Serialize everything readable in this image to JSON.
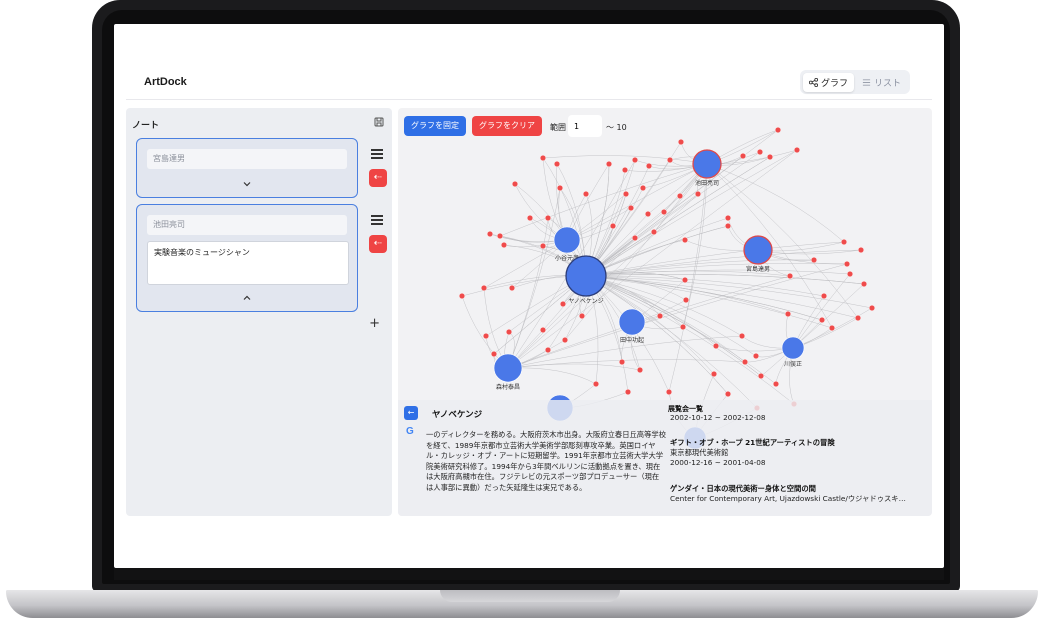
{
  "app": {
    "title": "ArtDock"
  },
  "view_toggle": {
    "graph_label": "グラフ",
    "list_label": "リスト",
    "active": "graph"
  },
  "notes_panel": {
    "title": "ノート",
    "cards": [
      {
        "name": "宮島達男",
        "memo": ""
      },
      {
        "name": "池田亮司",
        "memo": "実験音楽のミュージシャン"
      }
    ],
    "add_label": "+"
  },
  "graph_panel": {
    "fix_button": "グラフを固定",
    "clear_button": "グラフをクリア",
    "range_label": "範囲",
    "range_value": "1",
    "range_max_text": "〜 10",
    "colors": {
      "artist_node": "#4a78e8",
      "exhibition_node": "#ef4b4b",
      "edge": "#b9b9bd"
    },
    "labels": {
      "ikeda": "池田亮司",
      "koizumi": "小谷元彦",
      "miyajima": "宮島達男",
      "yanobe": "ヤノベケンジ",
      "tanaka": "田中功起",
      "morimura": "森村泰昌",
      "kawamata": "川俣正"
    }
  },
  "info_panel": {
    "name": "ヤノベケンジ",
    "bio": "一のディレクターを務める。大阪府茨木市出身。大阪府立春日丘高等学校を経て、1989年京都市立芸術大学美術学部彫刻専攻卒業。英国ロイヤル・カレッジ・オブ・アートに短期留学。1991年京都市立芸術大学大学院美術研究科修了。1994年から3年間ベルリンに活動拠点を置き、現在は大阪府高槻市在住。フジテレビの元スポーツ部プロデューサー（現在は人事部に異動）だった矢延隆生は実兄である。",
    "history_title": "展覧会一覧",
    "history": [
      {
        "title": "",
        "venue": "",
        "date": "2002-10-12 ~ 2002-12-08"
      },
      {
        "title": "ギフト・オブ・ホープ 21世紀アーティストの冒険",
        "venue": "東京都現代美術館",
        "date": "2000-12-16 ~ 2001-04-08"
      },
      {
        "title": "ゲンダイ・日本の現代美術ー身体と空間の間",
        "venue": "Center for Contemporary Art, Ujazdowski Castle/ウジャドゥスキ…",
        "date": ""
      }
    ]
  }
}
